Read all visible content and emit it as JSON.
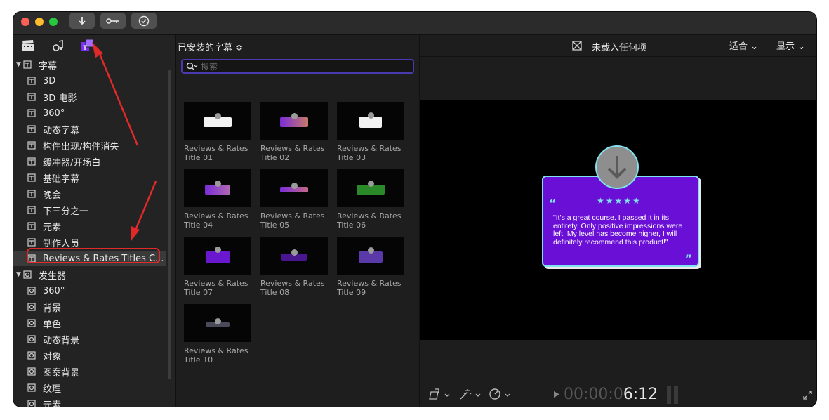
{
  "sidebar": {
    "icons": [
      "clapper-icon",
      "music-photo-icon",
      "titles-generators-icon"
    ],
    "titles_category": "字幕",
    "titles_items": [
      "3D",
      "3D 电影",
      "360°",
      "动态字幕",
      "构件出现/构件消失",
      "缓冲器/开场白",
      "基础字幕",
      "晚会",
      "下三分之一",
      "元素",
      "制作人员",
      "Reviews & Rates Titles C..."
    ],
    "generators_category": "发生器",
    "generator_items": [
      "360°",
      "背景",
      "单色",
      "动态背景",
      "对象",
      "图案背景",
      "纹理",
      "元素"
    ]
  },
  "browser": {
    "title": "已安装的字幕 ≎",
    "search_placeholder": "搜索",
    "thumbnails": [
      {
        "line1": "Reviews & Rates",
        "line2": "Title 01"
      },
      {
        "line1": "Reviews & Rates",
        "line2": "Title 02"
      },
      {
        "line1": "Reviews & Rates",
        "line2": "Title 03"
      },
      {
        "line1": "Reviews & Rates",
        "line2": "Title 04"
      },
      {
        "line1": "Reviews & Rates",
        "line2": "Title 05"
      },
      {
        "line1": "Reviews & Rates",
        "line2": "Title 06"
      },
      {
        "line1": "Reviews & Rates",
        "line2": "Title 07"
      },
      {
        "line1": "Reviews & Rates",
        "line2": "Title 08"
      },
      {
        "line1": "Reviews & Rates",
        "line2": "Title 09"
      },
      {
        "line1": "Reviews & Rates",
        "line2": "Title 10"
      }
    ]
  },
  "viewer": {
    "title": "未载入任何项",
    "fit_label": "适合 ⌄",
    "display_label": "显示 ⌄",
    "preview": {
      "stars": "★★★★★",
      "open_quote": "“",
      "close_quote": "”",
      "text": "\"It's a great course. I passed it in its entirety. Only positive impressions were left. My level has become higher, I will definitely recommend this product!\""
    },
    "timecode_dim": "00:00:0",
    "timecode_bright": "6:12"
  },
  "colors": {
    "accent_purple": "#6a0fd6",
    "accent_cyan": "#7fe3ef",
    "annotation_red": "#e02a2a",
    "search_border": "#4a3ab0"
  }
}
